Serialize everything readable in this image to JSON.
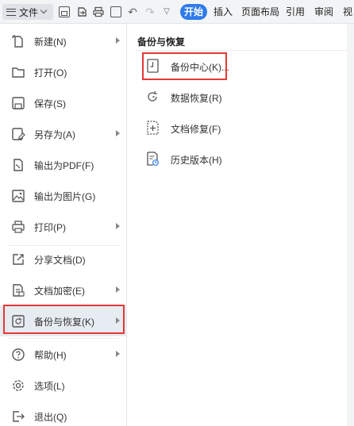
{
  "toolbar": {
    "file_label": "文件",
    "tabs": [
      "开始",
      "插入",
      "页面布局",
      "引用",
      "审阅",
      "视"
    ],
    "active_tab": "开始"
  },
  "file_menu": {
    "items": [
      {
        "label": "新建(N)",
        "icon": "new-file-icon",
        "has_submenu": true
      },
      {
        "label": "打开(O)",
        "icon": "folder-open-icon",
        "has_submenu": false
      },
      {
        "label": "保存(S)",
        "icon": "save-icon",
        "has_submenu": false
      },
      {
        "label": "另存为(A)",
        "icon": "save-as-icon",
        "has_submenu": true
      },
      {
        "label": "输出为PDF(F)",
        "icon": "export-pdf-icon",
        "has_submenu": false
      },
      {
        "label": "输出为图片(G)",
        "icon": "export-image-icon",
        "has_submenu": false
      },
      {
        "label": "打印(P)",
        "icon": "print-icon",
        "has_submenu": true
      },
      {
        "label": "分享文档(D)",
        "icon": "share-icon",
        "has_submenu": false
      },
      {
        "label": "文档加密(E)",
        "icon": "encrypt-doc-icon",
        "has_submenu": true
      },
      {
        "label": "备份与恢复(K)",
        "icon": "backup-restore-icon",
        "has_submenu": true,
        "selected": true
      },
      {
        "label": "帮助(H)",
        "icon": "help-icon",
        "has_submenu": true
      },
      {
        "label": "选项(L)",
        "icon": "settings-icon",
        "has_submenu": false
      },
      {
        "label": "退出(Q)",
        "icon": "exit-icon",
        "has_submenu": false
      }
    ]
  },
  "submenu": {
    "title": "备份与恢复",
    "items": [
      {
        "label": "备份中心(K)...",
        "icon": "backup-center-icon"
      },
      {
        "label": "数据恢复(R)",
        "icon": "data-recovery-icon"
      },
      {
        "label": "文档修复(F)",
        "icon": "doc-repair-icon"
      },
      {
        "label": "历史版本(H)",
        "icon": "history-version-icon"
      }
    ]
  },
  "colors": {
    "accent": "#2e7bea",
    "highlight_border": "#e53935",
    "selected_bg": "#e7ecf2"
  }
}
